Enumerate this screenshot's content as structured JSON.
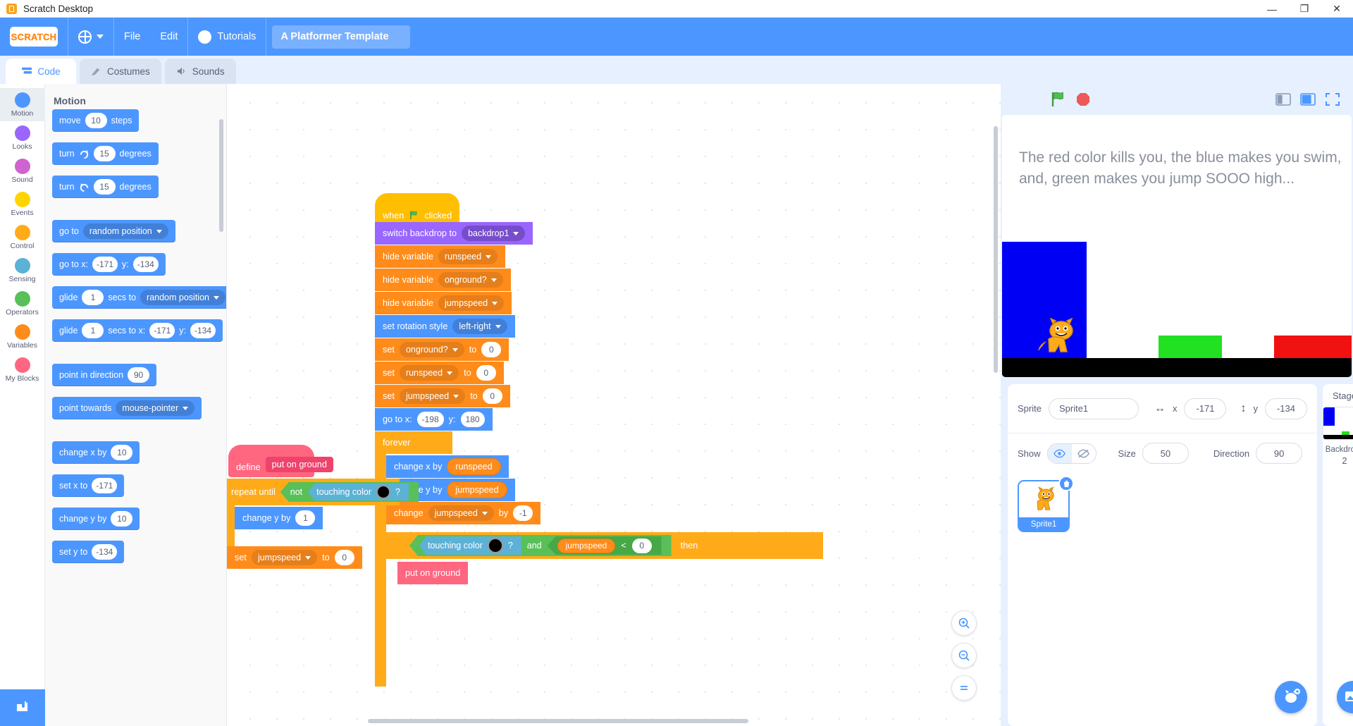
{
  "window": {
    "title": "Scratch Desktop",
    "minimize": "—",
    "maximize": "❐",
    "close": "✕"
  },
  "menubar": {
    "logo": "SCRATCH",
    "file": "File",
    "edit": "Edit",
    "tutorials": "Tutorials",
    "project_title": "A Platformer Template"
  },
  "tabs": [
    {
      "label": "Code",
      "icon": "code-icon"
    },
    {
      "label": "Costumes",
      "icon": "brush-icon"
    },
    {
      "label": "Sounds",
      "icon": "speaker-icon"
    }
  ],
  "categories": [
    {
      "label": "Motion",
      "color": "#4c97ff"
    },
    {
      "label": "Looks",
      "color": "#9966ff"
    },
    {
      "label": "Sound",
      "color": "#cf63cf"
    },
    {
      "label": "Events",
      "color": "#ffd500"
    },
    {
      "label": "Control",
      "color": "#ffab19"
    },
    {
      "label": "Sensing",
      "color": "#5cb1d6"
    },
    {
      "label": "Operators",
      "color": "#59c059"
    },
    {
      "label": "Variables",
      "color": "#ff8c1a"
    },
    {
      "label": "My Blocks",
      "color": "#ff6680"
    }
  ],
  "palette": {
    "heading": "Motion",
    "blocks": [
      {
        "parts": [
          "move"
        ],
        "num": "10",
        "tail": "steps"
      },
      {
        "parts": [
          "turn"
        ],
        "icon": "turn-right-icon",
        "num": "15",
        "tail": "degrees"
      },
      {
        "parts": [
          "turn"
        ],
        "icon": "turn-left-icon",
        "num": "15",
        "tail": "degrees"
      },
      {
        "parts": [
          "go to"
        ],
        "dropdown": "random position"
      },
      {
        "parts": [
          "go to x:"
        ],
        "num": "-171",
        "mid": "y:",
        "num2": "-134"
      },
      {
        "parts": [
          "glide"
        ],
        "num": "1",
        "mid": "secs to",
        "dropdown": "random position"
      },
      {
        "parts": [
          "glide"
        ],
        "num": "1",
        "mid": "secs to x:",
        "num2": "-171",
        "mid2": "y:",
        "num3": "-134"
      },
      {
        "parts": [
          "point in direction"
        ],
        "num": "90"
      },
      {
        "parts": [
          "point towards"
        ],
        "dropdown": "mouse-pointer"
      },
      {
        "parts": [
          "change x by"
        ],
        "num": "10"
      },
      {
        "parts": [
          "set x to"
        ],
        "num": "-171"
      },
      {
        "parts": [
          "change y by"
        ],
        "num": "10"
      },
      {
        "parts": [
          "set y to"
        ],
        "num": "-134"
      }
    ]
  },
  "script": {
    "when_flag_clicked": {
      "pre": "when",
      "post": "clicked"
    },
    "switch_backdrop": {
      "label": "switch backdrop to",
      "value": "backdrop1"
    },
    "hide_var_1": {
      "label": "hide variable",
      "value": "runspeed"
    },
    "hide_var_2": {
      "label": "hide variable",
      "value": "onground?"
    },
    "hide_var_3": {
      "label": "hide variable",
      "value": "jumpspeed"
    },
    "set_rotation": {
      "label": "set rotation style",
      "value": "left-right"
    },
    "set_onground": {
      "label": "set",
      "var": "onground?",
      "to": "to",
      "value": "0"
    },
    "set_runspeed": {
      "label": "set",
      "var": "runspeed",
      "to": "to",
      "value": "0"
    },
    "set_jumpspeed": {
      "label": "set",
      "var": "jumpspeed",
      "to": "to",
      "value": "0"
    },
    "go_to_xy": {
      "label": "go to x:",
      "x": "-198",
      "ylabel": "y:",
      "y": "180"
    },
    "forever": {
      "label": "forever"
    },
    "change_x_by": {
      "label": "change x by",
      "value": "runspeed"
    },
    "change_y_by": {
      "label": "change y by",
      "value": "jumpspeed"
    },
    "change_jumpspeed": {
      "label": "change",
      "var": "jumpspeed",
      "by": "by",
      "value": "-1"
    },
    "define_hat": {
      "label": "define",
      "proc": "put on ground"
    },
    "repeat_until": {
      "label": "repeat until"
    },
    "not_label": "not",
    "touching_color_1": {
      "label": "touching color",
      "q": "?",
      "color": "#000000"
    },
    "change_y_1": {
      "label": "change y by",
      "value": "1"
    },
    "set_jumpspeed_0": {
      "label": "set",
      "var": "jumpspeed",
      "to": "to",
      "value": "0"
    },
    "touching_color_2": {
      "label": "touching color",
      "q": "?",
      "color": "#000000"
    },
    "and_label": "and",
    "jumpspeed_var": "jumpspeed",
    "less_than": "<",
    "zero": "0",
    "then_label": "then",
    "put_on_ground_call": "put on ground"
  },
  "stage": {
    "message": "The red color kills you, the blue makes you swim, and, green makes you jump SOOO high...",
    "flag": "green-flag-icon",
    "stop": "stop-icon",
    "small_stage": "small-stage-icon",
    "large_stage": "large-stage-icon",
    "fullscreen": "fullscreen-icon"
  },
  "sprite_info": {
    "sprite_label": "Sprite",
    "sprite_name": "Sprite1",
    "x_label": "x",
    "x_value": "-171",
    "y_label": "y",
    "y_value": "-134",
    "show_label": "Show",
    "size_label": "Size",
    "size_value": "50",
    "direction_label": "Direction",
    "direction_value": "90",
    "card_name": "Sprite1"
  },
  "stage_panel": {
    "header": "Stage",
    "backdrops_label": "Backdrops",
    "backdrops_count": "2"
  },
  "zoom_controls": {
    "zoom_in": "zoom-in-icon",
    "zoom_out": "zoom-out-icon",
    "zoom_reset": "zoom-reset-icon"
  }
}
